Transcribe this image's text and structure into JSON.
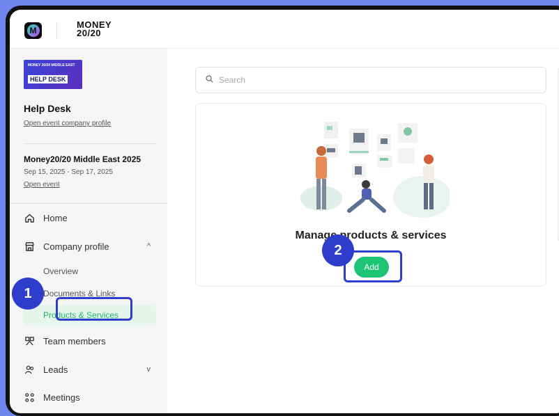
{
  "brand": {
    "logo_line1": "MONEY",
    "logo_line2": "20/20"
  },
  "sidebar": {
    "thumb_small": "MONEY 20/20  MIDDLE EAST",
    "thumb_label": "HELP DESK",
    "company_name": "Help Desk",
    "company_link": "Open event company profile",
    "event_name": "Money20/20 Middle East 2025",
    "event_dates": "Sep 15, 2025 - Sep 17, 2025",
    "event_link": "Open event",
    "nav": {
      "home": "Home",
      "company_profile": "Company profile",
      "overview": "Overview",
      "documents": "Documents & Links",
      "products": "Products & Services",
      "team": "Team members",
      "leads": "Leads",
      "meetings": "Meetings"
    }
  },
  "main": {
    "search_placeholder": "Search",
    "card_title": "Manage products & services",
    "add_label": "Add"
  },
  "annotations": {
    "step1": "1",
    "step2": "2"
  },
  "colors": {
    "accent_green": "#1cc473",
    "annotation_blue": "#2e3dcc",
    "background": "#6f86ee"
  }
}
